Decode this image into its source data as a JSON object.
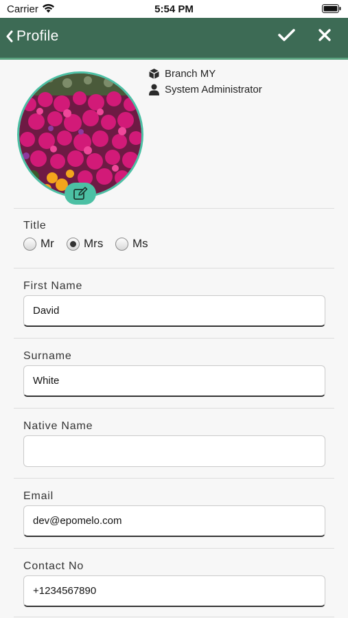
{
  "status_bar": {
    "carrier": "Carrier",
    "time": "5:54 PM"
  },
  "nav": {
    "title": "Profile",
    "back_icon": "chevron-left-icon",
    "confirm_icon": "check-icon",
    "close_icon": "close-icon"
  },
  "profile": {
    "avatar_icon": "flower-photo",
    "edit_icon": "edit-icon",
    "branch": "Branch MY",
    "branch_icon": "cube-icon",
    "role": "System Administrator",
    "role_icon": "user-icon"
  },
  "form": {
    "title": {
      "label": "Title",
      "options": [
        {
          "label": "Mr",
          "checked": false
        },
        {
          "label": "Mrs",
          "checked": true
        },
        {
          "label": "Ms",
          "checked": false
        }
      ]
    },
    "first_name": {
      "label": "First Name",
      "value": "David"
    },
    "surname": {
      "label": "Surname",
      "value": "White"
    },
    "native_name": {
      "label": "Native Name",
      "value": ""
    },
    "email": {
      "label": "Email",
      "value": "dev@epomelo.com"
    },
    "contact_no": {
      "label": "Contact No",
      "value": "+1234567890"
    }
  },
  "colors": {
    "nav_bg": "#3d6b55",
    "accent": "#4cc0a4"
  }
}
